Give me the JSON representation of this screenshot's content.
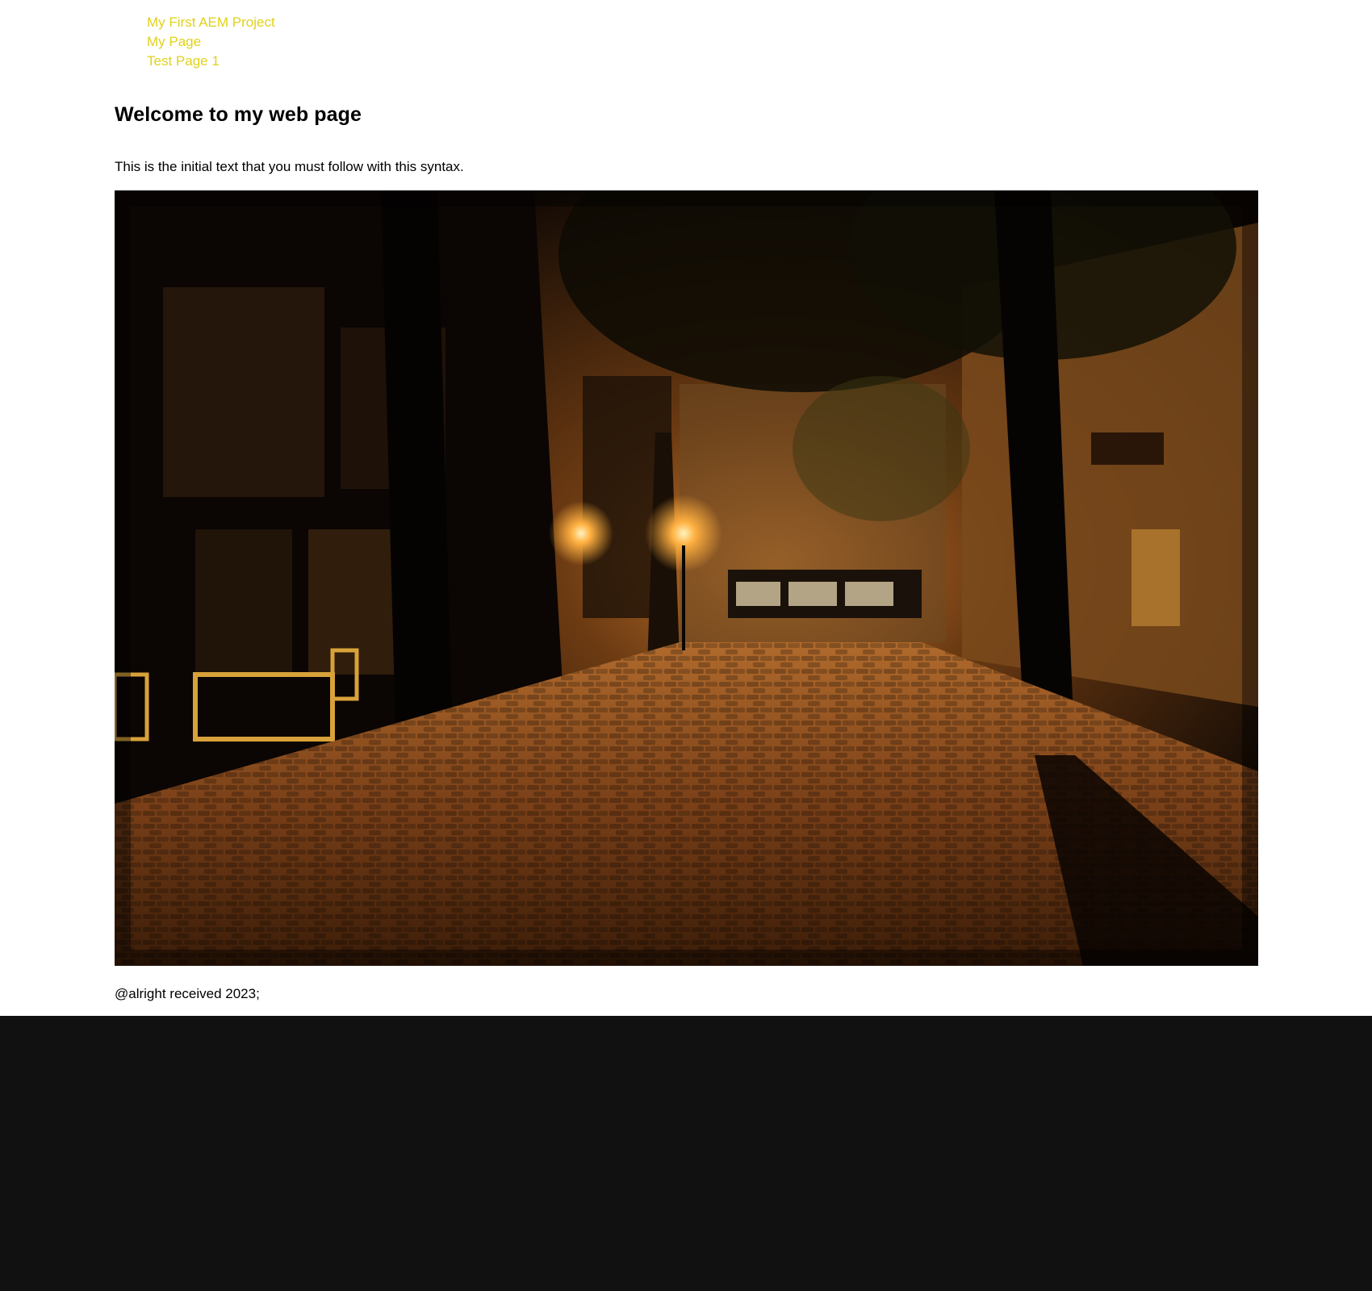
{
  "nav": {
    "items": [
      {
        "label": "My First AEM Project"
      },
      {
        "label": "My Page"
      },
      {
        "label": "Test Page 1"
      }
    ],
    "link_color": "#e0d21b"
  },
  "header": {
    "title": "Welcome to my web page"
  },
  "main": {
    "intro_text": "This is the initial text that you must follow with this syntax.",
    "hero_image": {
      "alt": "cobblestone-street-at-night-photo"
    }
  },
  "footer": {
    "text": "@alright received 2023;"
  },
  "colors": {
    "page_bg": "#ffffff",
    "bottom_bg": "#111111"
  }
}
